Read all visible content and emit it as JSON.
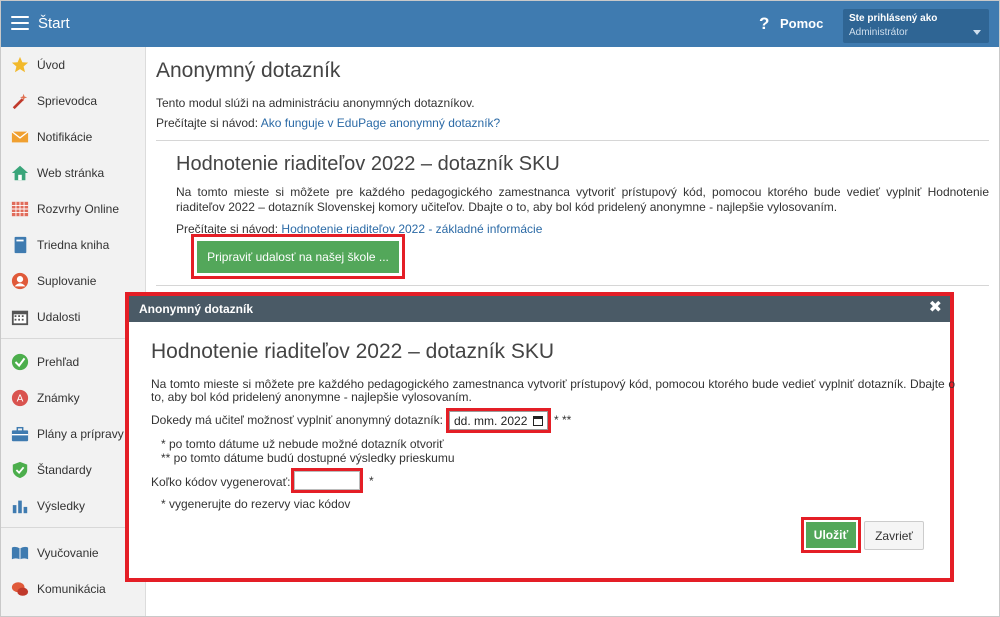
{
  "header": {
    "app_title": "Štart",
    "help_icon": "?",
    "help_label": "Pomoc",
    "user_line1": "Ste prihlásený ako",
    "user_line2": "Administrátor"
  },
  "sidebar": {
    "items": [
      {
        "label": "Úvod",
        "icon": "star-icon",
        "color": "#f2b92b"
      },
      {
        "label": "Sprievodca",
        "icon": "magic-wand-icon",
        "color": "#d9534f"
      },
      {
        "label": "Notifikácie",
        "icon": "envelope-icon",
        "color": "#f0a030"
      },
      {
        "label": "Web stránka",
        "icon": "home-icon",
        "color": "#3aa57a"
      },
      {
        "label": "Rozvrhy Online",
        "icon": "timetable-grid-icon",
        "color": "#e06b5a"
      },
      {
        "label": "Triedna kniha",
        "icon": "book-icon",
        "color": "#3f7bb0"
      },
      {
        "label": "Suplovanie",
        "icon": "substitute-person-icon",
        "color": "#e05a3a"
      },
      {
        "label": "Udalosti",
        "icon": "calendar-icon",
        "color": "#555555"
      },
      {
        "label": "Prehľad",
        "icon": "check-circle-icon",
        "color": "#4cae4c"
      },
      {
        "label": "Známky",
        "icon": "grades-icon",
        "color": "#d9534f"
      },
      {
        "label": "Plány a prípravy",
        "icon": "briefcase-icon",
        "color": "#3f7bb0"
      },
      {
        "label": "Štandardy",
        "icon": "shield-check-icon",
        "color": "#4cae4c"
      },
      {
        "label": "Výsledky",
        "icon": "bar-chart-icon",
        "color": "#3f7bb0"
      },
      {
        "label": "Vyučovanie",
        "icon": "open-book-icon",
        "color": "#3f7bb0"
      },
      {
        "label": "Komunikácia",
        "icon": "chat-bubbles-icon",
        "color": "#e05a3a"
      }
    ]
  },
  "main": {
    "page_title": "Anonymný dotazník",
    "intro": "Tento modul slúži na administráciu anonymných dotazníkov.",
    "guide_prefix": "Prečítajte si návod:",
    "guide_link": "Ako funguje v EduPage anonymný dotazník?",
    "section": {
      "title": "Hodnotenie riaditeľov 2022 – dotazník SKU",
      "text": "Na tomto mieste si môžete pre každého pedagogického zamestnanca vytvoriť prístupový kód, pomocou ktorého bude vedieť vyplniť Hodnotenie riaditeľov 2022 – dotazník Slovenskej komory učiteľov. Dbajte o to, aby bol kód pridelený anonymne - najlepšie vylosovaním.",
      "guide_prefix": "Prečítajte si návod:",
      "guide_link": "Hodnotenie riaditeľov 2022 - základné informácie",
      "prepare_button": "Pripraviť udalosť na našej škole ..."
    }
  },
  "modal": {
    "header_title": "Anonymný dotazník",
    "close_icon": "✖",
    "title": "Hodnotenie riaditeľov 2022 – dotazník SKU",
    "text": "Na tomto mieste si môžete pre každého pedagogického zamestnanca vytvoriť prístupový kód, pomocou ktorého bude vedieť vyplniť dotazník. Dbajte o to, aby bol kód pridelený anonymne - najlepšie vylosovaním.",
    "deadline_label": "Dokedy má učiteľ možnosť vyplniť anonymný dotazník:",
    "date_value": "dd. mm. 2022",
    "deadline_stars": "* **",
    "note1": "* po tomto dátume už nebude možné dotazník otvoriť",
    "note2": "** po tomto dátume budú dostupné výsledky prieskumu",
    "count_label": "Koľko kódov vygenerovať:",
    "count_value": "",
    "count_star": "*",
    "note3": "* vygenerujte do rezervy viac kódov",
    "save_button": "Uložiť",
    "close_button": "Zavrieť"
  },
  "colors": {
    "topbar": "#3f7bb0",
    "accent_green": "#53a75a",
    "highlight_red": "#e41e26",
    "modal_header": "#4a5a66",
    "link": "#2b6aa6"
  }
}
